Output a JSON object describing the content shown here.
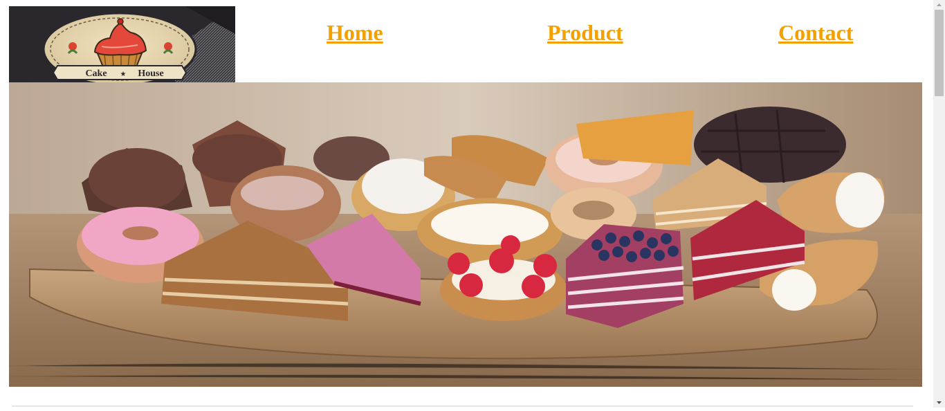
{
  "logo": {
    "text_left": "Cake",
    "text_right": "House",
    "star": "★"
  },
  "nav": {
    "items": [
      {
        "label": "Home"
      },
      {
        "label": "Product"
      },
      {
        "label": "Contact"
      }
    ],
    "link_color": "#f4a100"
  },
  "hero": {
    "icon": "pastry-assortment-photo"
  },
  "scrollbar": {
    "up_icon": "chevron-up-icon",
    "down_icon": "chevron-down-icon"
  }
}
